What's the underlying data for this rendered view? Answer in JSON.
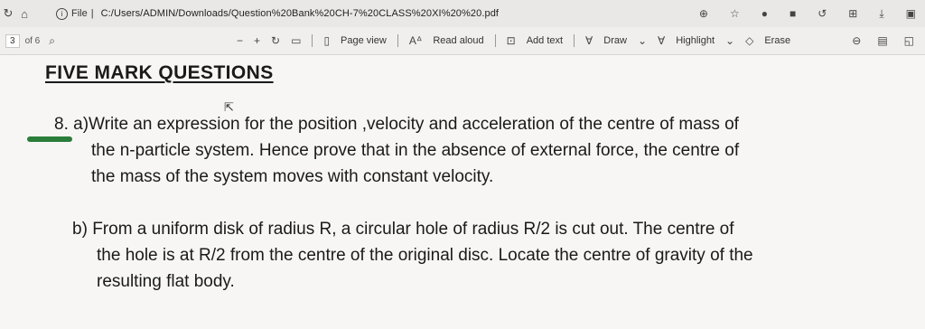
{
  "address_bar": {
    "info_label": "File",
    "url": "C:/Users/ADMIN/Downloads/Question%20Bank%20CH-7%20CLASS%20XI%20%20.pdf"
  },
  "toolbar": {
    "page_current": "3",
    "page_total": "of 6",
    "page_view_label": "Page view",
    "read_aloud_label": "Read aloud",
    "add_text_label": "Add text",
    "draw_label": "Draw",
    "highlight_label": "Highlight",
    "erase_label": "Erase"
  },
  "document": {
    "heading": "FIVE  MARK  QUESTIONS",
    "q8a_number": "8. a)",
    "q8a_line1": "Write  an expression for the position ,velocity and acceleration of the centre of mass of",
    "q8a_line2": "the n-particle system. Hence prove that in the absence of external force, the centre of",
    "q8a_line3": "the mass of the system moves with constant velocity.",
    "q8b_number": "b)",
    "q8b_line1": "From a uniform disk of radius R, a circular hole of radius R/2 is cut out. The centre of",
    "q8b_line2": "the hole is at R/2 from the centre of the original disc. Locate the centre of gravity of the",
    "q8b_line3": "resulting flat body."
  },
  "colors": {
    "highlight_marker": "#2a7d3a"
  }
}
